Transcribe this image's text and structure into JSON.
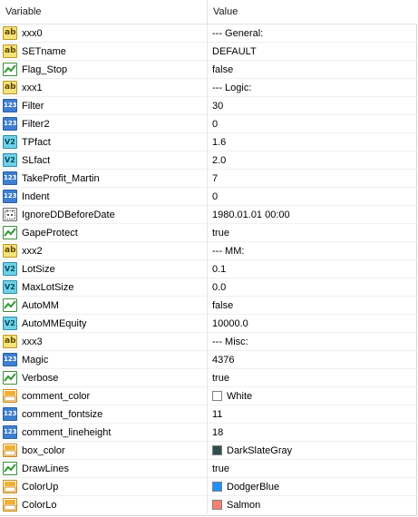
{
  "header": {
    "variable": "Variable",
    "value": "Value"
  },
  "rows": [
    {
      "icon": "ab",
      "name": "xxx0",
      "value": "--- General:"
    },
    {
      "icon": "ab",
      "name": "SETname",
      "value": "DEFAULT"
    },
    {
      "icon": "bool",
      "name": "Flag_Stop",
      "value": "false"
    },
    {
      "icon": "ab",
      "name": "xxx1",
      "value": "--- Logic:"
    },
    {
      "icon": "123",
      "name": "Filter",
      "value": "30"
    },
    {
      "icon": "123",
      "name": "Filter2",
      "value": "0"
    },
    {
      "icon": "v2",
      "name": "TPfact",
      "value": "1.6"
    },
    {
      "icon": "v2",
      "name": "SLfact",
      "value": "2.0"
    },
    {
      "icon": "123",
      "name": "TakeProfit_Martin",
      "value": "7"
    },
    {
      "icon": "123",
      "name": "Indent",
      "value": "0"
    },
    {
      "icon": "date",
      "name": "IgnoreDDBeforeDate",
      "value": "1980.01.01 00:00"
    },
    {
      "icon": "bool",
      "name": "GapeProtect",
      "value": "true"
    },
    {
      "icon": "ab",
      "name": "xxx2",
      "value": "--- MM:"
    },
    {
      "icon": "v2",
      "name": "LotSize",
      "value": "0.1"
    },
    {
      "icon": "v2",
      "name": "MaxLotSize",
      "value": "0.0"
    },
    {
      "icon": "bool",
      "name": "AutoMM",
      "value": "false"
    },
    {
      "icon": "v2",
      "name": "AutoMMEquity",
      "value": "10000.0"
    },
    {
      "icon": "ab",
      "name": "xxx3",
      "value": "--- Misc:"
    },
    {
      "icon": "123",
      "name": "Magic",
      "value": "4376"
    },
    {
      "icon": "bool",
      "name": "Verbose",
      "value": "true"
    },
    {
      "icon": "color",
      "name": "comment_color",
      "value": "White",
      "swatch": "#ffffff"
    },
    {
      "icon": "123",
      "name": "comment_fontsize",
      "value": "11"
    },
    {
      "icon": "123",
      "name": "comment_lineheight",
      "value": "18"
    },
    {
      "icon": "color",
      "name": "box_color",
      "value": "DarkSlateGray",
      "swatch": "#2f4f4f"
    },
    {
      "icon": "bool",
      "name": "DrawLines",
      "value": "true"
    },
    {
      "icon": "color",
      "name": "ColorUp",
      "value": "DodgerBlue",
      "swatch": "#1e90ff"
    },
    {
      "icon": "color",
      "name": "ColorLo",
      "value": "Salmon",
      "swatch": "#fa8072"
    }
  ],
  "icon_labels": {
    "ab": "ab",
    "123": "123",
    "v2": "V2"
  },
  "colors": {
    "grid_line": "#e6e6e6",
    "header_text": "#1a1a1a"
  }
}
